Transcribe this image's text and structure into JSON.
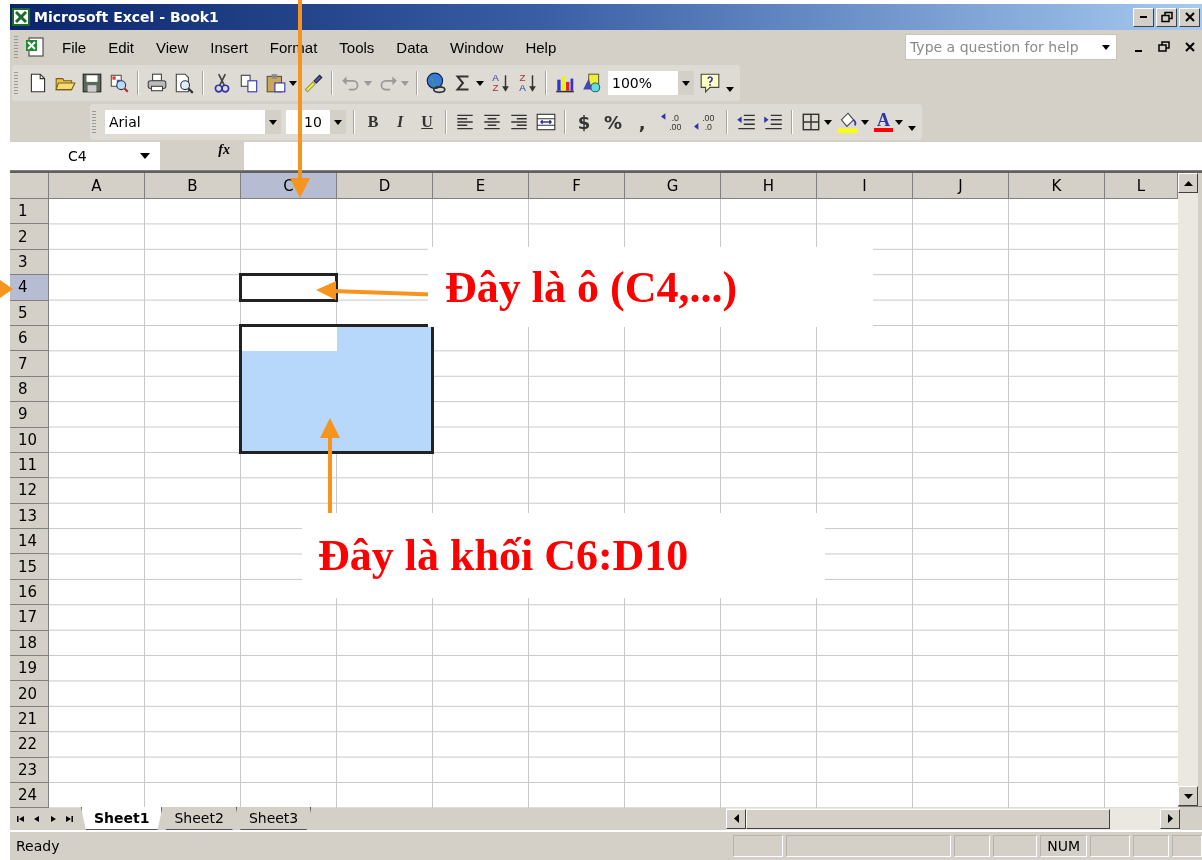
{
  "window": {
    "title": "Microsoft Excel - Book1"
  },
  "menu": [
    {
      "label": "File"
    },
    {
      "label": "Edit"
    },
    {
      "label": "View"
    },
    {
      "label": "Insert"
    },
    {
      "label": "Format"
    },
    {
      "label": "Tools"
    },
    {
      "label": "Data"
    },
    {
      "label": "Window"
    },
    {
      "label": "Help"
    }
  ],
  "help_box": {
    "placeholder": "Type a question for help"
  },
  "standard_toolbar": {
    "sort": [
      {
        "top": "A",
        "bottom": "Z"
      },
      {
        "top": "Z",
        "bottom": "A"
      }
    ],
    "zoom": "100%"
  },
  "formatting_toolbar": {
    "font": "Arial",
    "size": "10",
    "style_buttons": [
      {
        "label": "B",
        "kind": "bold"
      },
      {
        "label": "I",
        "kind": "italic"
      },
      {
        "label": "U",
        "kind": "underline"
      }
    ],
    "number_buttons": [
      {
        "label": "$"
      },
      {
        "label": "%"
      },
      {
        "label": ","
      }
    ],
    "decimal_buttons": [
      {
        "top": ".0",
        "bottom": ".00"
      },
      {
        "top": ".00",
        "bottom": ".0"
      }
    ],
    "font_color_letter": "A"
  },
  "formula_bar": {
    "name_box": "C4",
    "function_label": "fx"
  },
  "columns": [
    {
      "label": "A",
      "selected": false
    },
    {
      "label": "B",
      "selected": false
    },
    {
      "label": "C",
      "selected": true
    },
    {
      "label": "D",
      "selected": false
    },
    {
      "label": "E",
      "selected": false
    },
    {
      "label": "F",
      "selected": false
    },
    {
      "label": "G",
      "selected": false
    },
    {
      "label": "H",
      "selected": false
    },
    {
      "label": "I",
      "selected": false
    },
    {
      "label": "J",
      "selected": false
    },
    {
      "label": "K",
      "selected": false
    },
    {
      "label": "L",
      "selected": false
    }
  ],
  "rows": [
    {
      "label": "1",
      "selected": false
    },
    {
      "label": "2",
      "selected": false
    },
    {
      "label": "3",
      "selected": false
    },
    {
      "label": "4",
      "selected": true
    },
    {
      "label": "5",
      "selected": false
    },
    {
      "label": "6",
      "selected": false
    },
    {
      "label": "7",
      "selected": false
    },
    {
      "label": "8",
      "selected": false
    },
    {
      "label": "9",
      "selected": false
    },
    {
      "label": "10",
      "selected": false
    },
    {
      "label": "11",
      "selected": false
    },
    {
      "label": "12",
      "selected": false
    },
    {
      "label": "13",
      "selected": false
    },
    {
      "label": "14",
      "selected": false
    },
    {
      "label": "15",
      "selected": false
    },
    {
      "label": "16",
      "selected": false
    },
    {
      "label": "17",
      "selected": false
    },
    {
      "label": "18",
      "selected": false
    },
    {
      "label": "19",
      "selected": false
    },
    {
      "label": "20",
      "selected": false
    },
    {
      "label": "21",
      "selected": false
    },
    {
      "label": "22",
      "selected": false
    },
    {
      "label": "23",
      "selected": false
    },
    {
      "label": "24",
      "selected": false
    }
  ],
  "selections": [
    {
      "kind": "outline"
    },
    {
      "kind": "filled_range"
    }
  ],
  "sheet_tabs": [
    {
      "label": "Sheet1",
      "selected": true
    },
    {
      "label": "Sheet2",
      "selected": false
    },
    {
      "label": "Sheet3",
      "selected": false
    }
  ],
  "status_bar": {
    "mode": "Ready",
    "indicator": "NUM"
  },
  "annotations": [
    {
      "text": "Đây là ô (C4,...)"
    },
    {
      "text": "Đây là khối C6:D10"
    }
  ]
}
